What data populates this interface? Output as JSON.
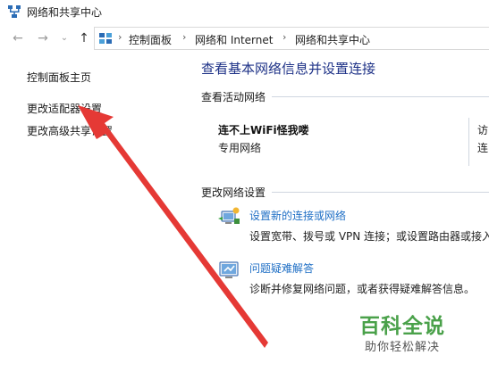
{
  "window": {
    "title": "网络和共享中心"
  },
  "nav": {
    "back_icon": "arrow-left-icon",
    "forward_icon": "arrow-right-icon",
    "history_icon": "chevron-down-icon",
    "up_icon": "arrow-up-icon",
    "breadcrumb": [
      "控制面板",
      "网络和 Internet",
      "网络和共享中心"
    ]
  },
  "sidebar": {
    "items": [
      {
        "label": "控制面板主页"
      },
      {
        "label": "更改适配器设置"
      },
      {
        "label": "更改高级共享设置"
      }
    ]
  },
  "main": {
    "heading": "查看基本网络信息并设置连接",
    "active_networks_title": "查看活动网络",
    "network_name": "连不上WiFi怪我喽",
    "network_type": "专用网络",
    "cut_right_1": "访",
    "cut_right_2": "连",
    "change_settings_title": "更改网络设置",
    "tasks": [
      {
        "icon": "new-connection-icon",
        "link": "设置新的连接或网络",
        "desc": "设置宽带、拨号或 VPN 连接；或设置路由器或接入"
      },
      {
        "icon": "troubleshoot-icon",
        "link": "问题疑难解答",
        "desc": "诊断并修复网络问题，或者获得疑难解答信息。"
      }
    ]
  },
  "watermark": {
    "main": "百科全说",
    "sub": "助你轻松解决"
  },
  "colors": {
    "heading": "#1e3287",
    "link": "#1f6fc5",
    "annotation_arrow": "#e53935",
    "watermark": "#4aa14a"
  }
}
